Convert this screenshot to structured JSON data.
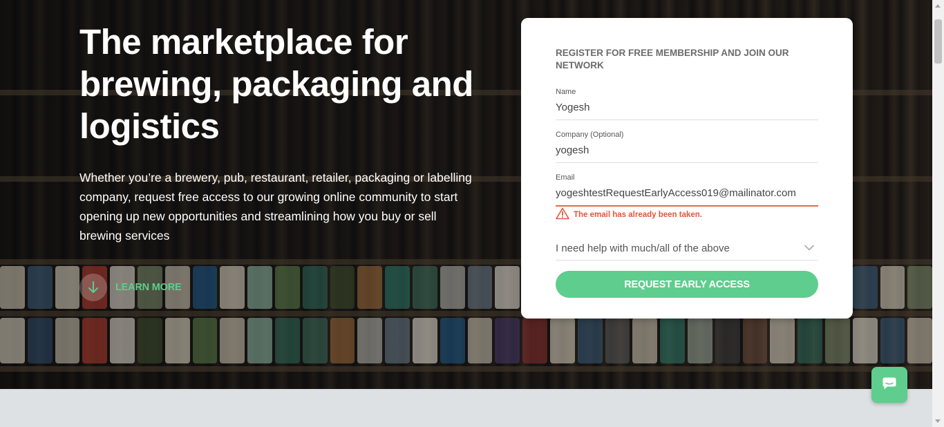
{
  "hero": {
    "headline": "The marketplace for brewing, packaging and logistics",
    "subtext": "Whether you’re a brewery, pub, restaurant, retailer, packaging or labelling company, request free access to our growing online community to start opening up new opportunities and streamlining how you buy or sell brewing services",
    "learn_more_label": "LEARN MORE",
    "learn_more_icon": "arrow-down-icon"
  },
  "form": {
    "title": "REGISTER FOR FREE MEMBERSHIP AND JOIN OUR NETWORK",
    "name": {
      "label": "Name",
      "value": "Yogesh"
    },
    "company": {
      "label": "Company (Optional)",
      "value": "yogesh"
    },
    "email": {
      "label": "Email",
      "value": "yogeshtestRequestEarlyAccess019@mailinator.com"
    },
    "email_error": "The email has already been taken.",
    "help_select": {
      "selected": "I need help with much/all of the above"
    },
    "submit_label": "REQUEST EARLY ACCESS"
  },
  "chat": {
    "icon": "chat-bubble-icon"
  },
  "colors": {
    "accent": "#5fcd8d",
    "error": "#e2563a",
    "footer_bg": "#dde1e4"
  }
}
